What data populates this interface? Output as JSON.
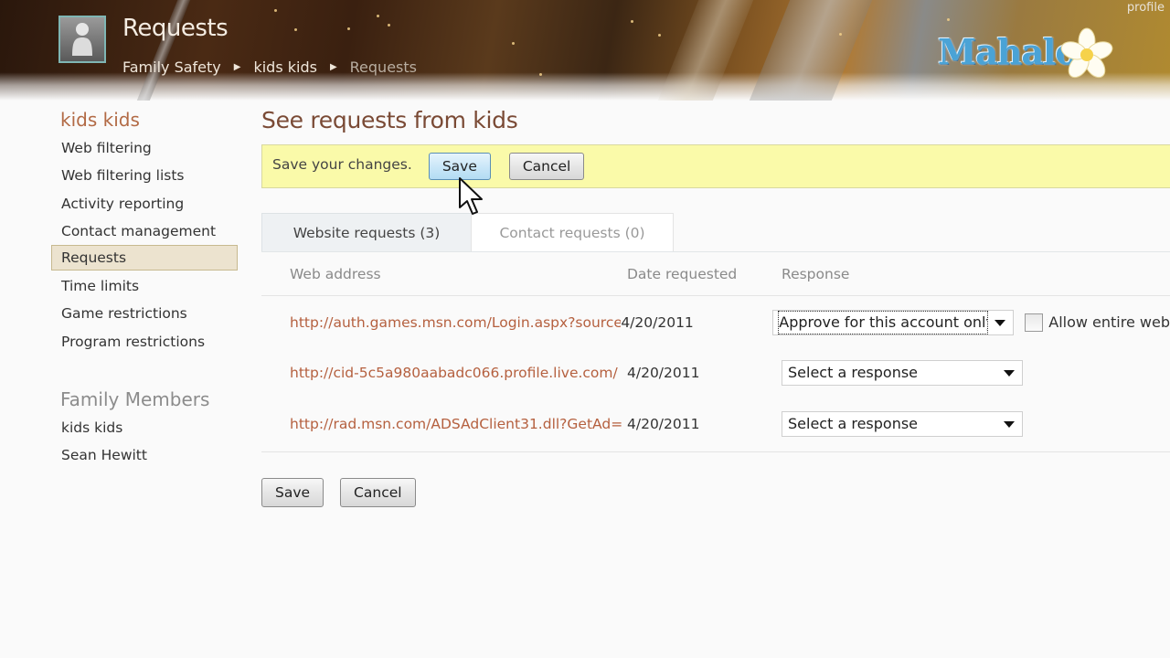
{
  "header": {
    "title": "Requests",
    "breadcrumb": [
      "Family Safety",
      "kids kids",
      "Requests"
    ],
    "profile_link": "profile",
    "logo_text": "Mahalo",
    "avatar_icon": "user-avatar-icon",
    "separator_icon": "triangle-right-icon"
  },
  "sidebar": {
    "account_name": "kids kids",
    "items": [
      {
        "label": "Web filtering",
        "active": false
      },
      {
        "label": "Web filtering lists",
        "active": false
      },
      {
        "label": "Activity reporting",
        "active": false
      },
      {
        "label": "Contact management",
        "active": false
      },
      {
        "label": "Requests",
        "active": true
      },
      {
        "label": "Time limits",
        "active": false
      },
      {
        "label": "Game restrictions",
        "active": false
      },
      {
        "label": "Program restrictions",
        "active": false
      }
    ],
    "members_title": "Family Members",
    "members": [
      "kids kids",
      "Sean Hewitt"
    ]
  },
  "main": {
    "title": "See requests from kids",
    "savebar": {
      "message": "Save your changes.",
      "save_label": "Save",
      "cancel_label": "Cancel"
    },
    "tabs": [
      {
        "label": "Website requests (3)",
        "active": true
      },
      {
        "label": "Contact requests (0)",
        "active": false
      }
    ],
    "table": {
      "headers": [
        "Web address",
        "Date requested",
        "Response"
      ],
      "rows": [
        {
          "address": "http://auth.games.msn.com/Login.aspx?source",
          "date": "4/20/2011",
          "response": "Approve for this account only",
          "allow_checkbox_label": "Allow entire web",
          "allow_checked": false
        },
        {
          "address": "http://cid-5c5a980aabadc066.profile.live.com/",
          "date": "4/20/2011",
          "response": "Select a response"
        },
        {
          "address": "http://rad.msn.com/ADSAdClient31.dll?GetAd=",
          "date": "4/20/2011",
          "response": "Select a response"
        }
      ]
    },
    "bottom": {
      "save_label": "Save",
      "cancel_label": "Cancel"
    }
  },
  "colors": {
    "accent_title": "#7a4a35",
    "link": "#b5603f",
    "savebar_bg": "#fafaa9",
    "active_nav_bg": "#ece3cf"
  }
}
